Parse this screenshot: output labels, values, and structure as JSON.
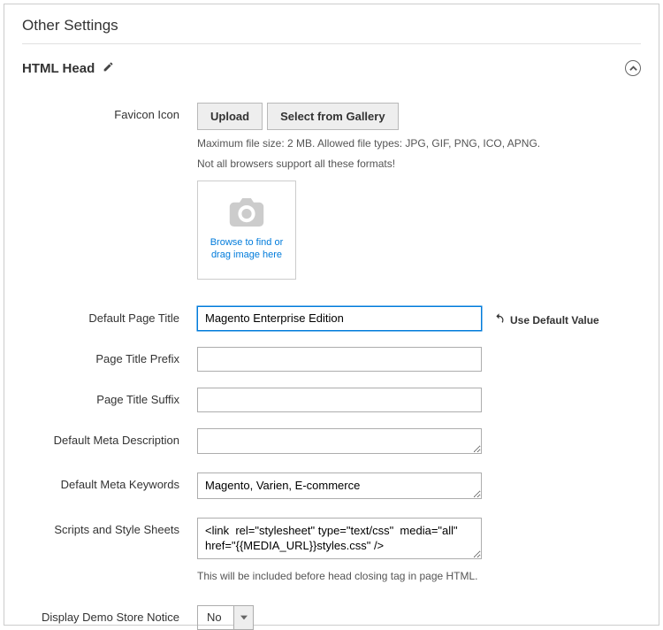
{
  "panel": {
    "title": "Other Settings"
  },
  "section": {
    "title": "HTML Head"
  },
  "favicon": {
    "label": "Favicon Icon",
    "upload_btn": "Upload",
    "gallery_btn": "Select from Gallery",
    "hint_size": "Maximum file size: 2 MB. Allowed file types: JPG, GIF, PNG, ICO, APNG.",
    "hint_browsers": "Not all browsers support all these formats!",
    "browse_text": "Browse to find or drag image here"
  },
  "default_page_title": {
    "label": "Default Page Title",
    "value": "Magento Enterprise Edition",
    "use_default": "Use Default Value"
  },
  "page_title_prefix": {
    "label": "Page Title Prefix",
    "value": ""
  },
  "page_title_suffix": {
    "label": "Page Title Suffix",
    "value": ""
  },
  "meta_description": {
    "label": "Default Meta Description",
    "value": ""
  },
  "meta_keywords": {
    "label": "Default Meta Keywords",
    "value": "Magento, Varien, E-commerce"
  },
  "scripts": {
    "label": "Scripts and Style Sheets",
    "value": "<link  rel=\"stylesheet\" type=\"text/css\"  media=\"all\" href=\"{{MEDIA_URL}}styles.css\" />",
    "hint": "This will be included before head closing tag in page HTML."
  },
  "demo_notice": {
    "label": "Display Demo Store Notice",
    "value": "No"
  }
}
